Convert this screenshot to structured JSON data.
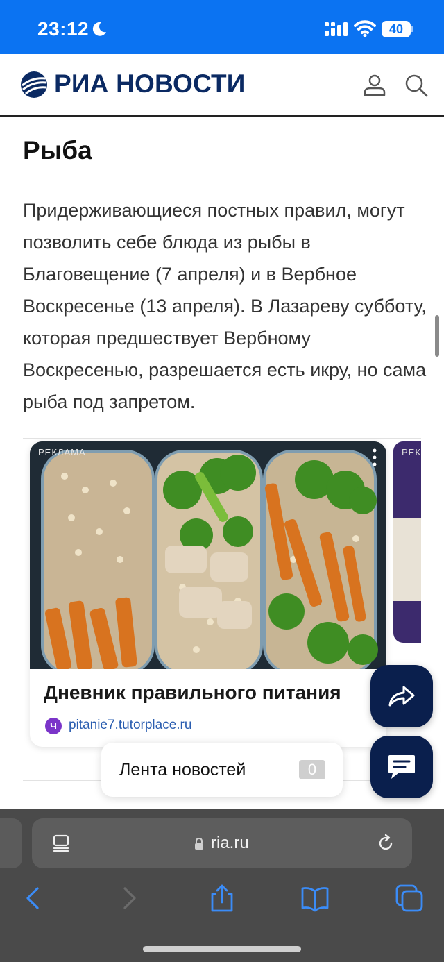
{
  "status_bar": {
    "time": "23:12",
    "battery": "40"
  },
  "header": {
    "logo_text": "РИА НОВОСТИ",
    "icons": [
      "user-icon",
      "search-icon"
    ]
  },
  "article": {
    "section_title": "Рыба",
    "paragraph": "Придерживающиеся постных правил, могут позволить себе блюда из рыбы в Благовещение (7 апреля) и в Вербное Воскресенье (13 апреля). В Лазареву субботу, которая предшествует Вербному Воскресенью, разрешается есть икру, но сама рыба под запретом."
  },
  "ad": {
    "label": "РЕКЛАМА",
    "title": "Дневник правильного питания",
    "domain": "pitanie7.tutorplace.ru",
    "domain_icon_letter": "Ч",
    "second_label": "РЕК"
  },
  "news_feed": {
    "label": "Лента новостей",
    "count": "0"
  },
  "safari": {
    "url": "ria.ru"
  },
  "colors": {
    "status_bar": "#0b73f2",
    "logo": "#0b2a63",
    "fab": "#0a1f4d",
    "safari_bar": "#4a4a4a",
    "safari_accent": "#3b8cf7"
  }
}
